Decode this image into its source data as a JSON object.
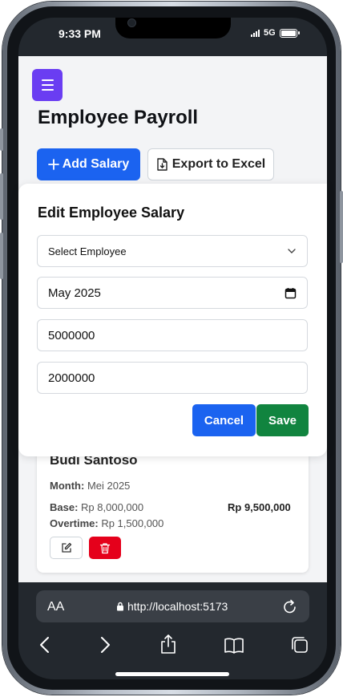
{
  "status_bar": {
    "time": "9:33 PM",
    "network": "5G"
  },
  "app": {
    "title": "Employee Payroll",
    "add_salary_label": "Add Salary",
    "export_label": "Export to Excel"
  },
  "modal": {
    "title": "Edit Employee Salary",
    "employee_select": {
      "value": "Select Employee"
    },
    "month_field": {
      "value": "May 2025"
    },
    "base_field": {
      "value": "5000000"
    },
    "overtime_field": {
      "value": "2000000"
    },
    "cancel_label": "Cancel",
    "save_label": "Save"
  },
  "record": {
    "name": "Budi Santoso",
    "month_label": "Month:",
    "month_value": "Mei 2025",
    "base_label": "Base:",
    "base_value": "Rp 8,000,000",
    "overtime_label": "Overtime:",
    "overtime_value": "Rp 1,500,000",
    "total": "Rp 9,500,000"
  },
  "browser": {
    "text_size_label": "AA",
    "url": "http://localhost:5173"
  },
  "colors": {
    "primary": "#1b63f0",
    "menu": "#6a3df2",
    "save": "#11843f",
    "delete": "#e5001b"
  },
  "icons": [
    "menu-icon",
    "plus-icon",
    "file-export-icon",
    "chevron-down-icon",
    "calendar-icon",
    "edit-icon",
    "trash-icon",
    "lock-icon",
    "reload-icon",
    "back-icon",
    "forward-icon",
    "share-icon",
    "bookmarks-icon",
    "tabs-icon"
  ]
}
